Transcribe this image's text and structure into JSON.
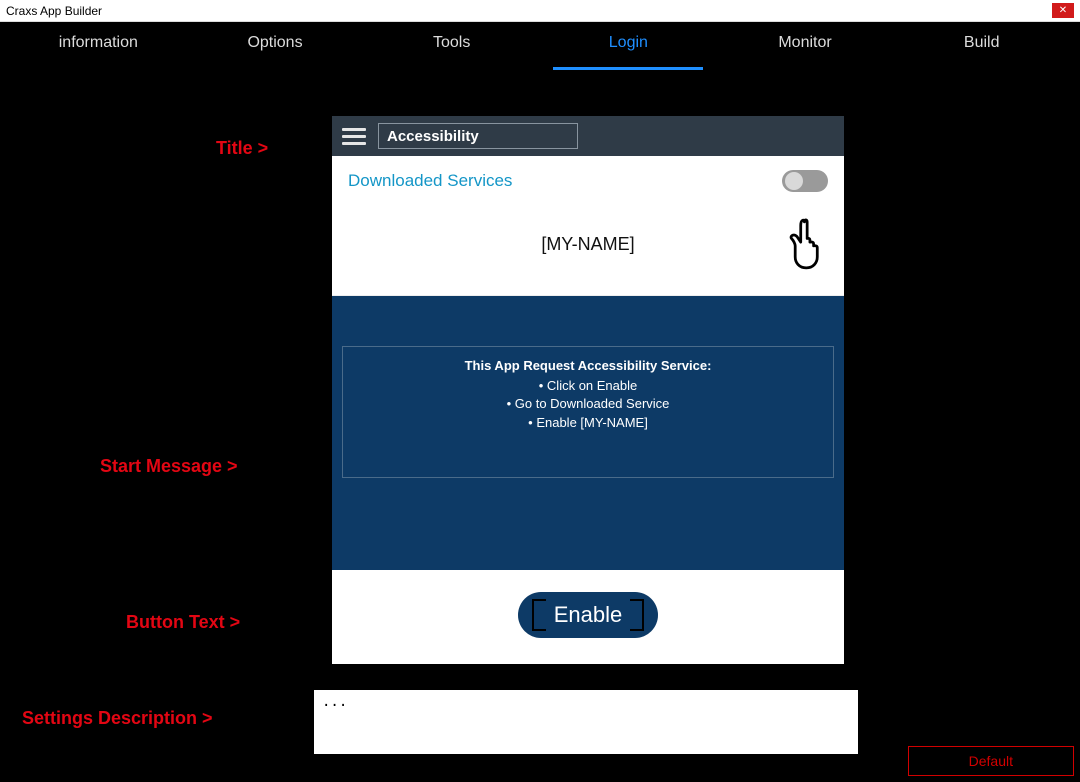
{
  "window": {
    "title": "Craxs App Builder"
  },
  "tabs": {
    "items": [
      {
        "label": "information"
      },
      {
        "label": "Options"
      },
      {
        "label": "Tools"
      },
      {
        "label": "Login"
      },
      {
        "label": "Monitor"
      },
      {
        "label": "Build"
      }
    ],
    "active_index": 3
  },
  "side_labels": {
    "title": "Title >",
    "start_message": "Start Message >",
    "button_text": "Button Text >",
    "settings_description": "Settings Description >"
  },
  "preview": {
    "title_value": "Accessibility",
    "downloaded_services": "Downloaded Services",
    "my_name": "[MY-NAME]",
    "message": {
      "heading": "This App Request Accessibility Service:",
      "line1": "• Click on Enable",
      "line2": "• Go to Downloaded Service",
      "line3": "• Enable [MY-NAME]"
    },
    "enable_label": "Enable"
  },
  "settings_description_value": "...",
  "buttons": {
    "default": "Default"
  }
}
